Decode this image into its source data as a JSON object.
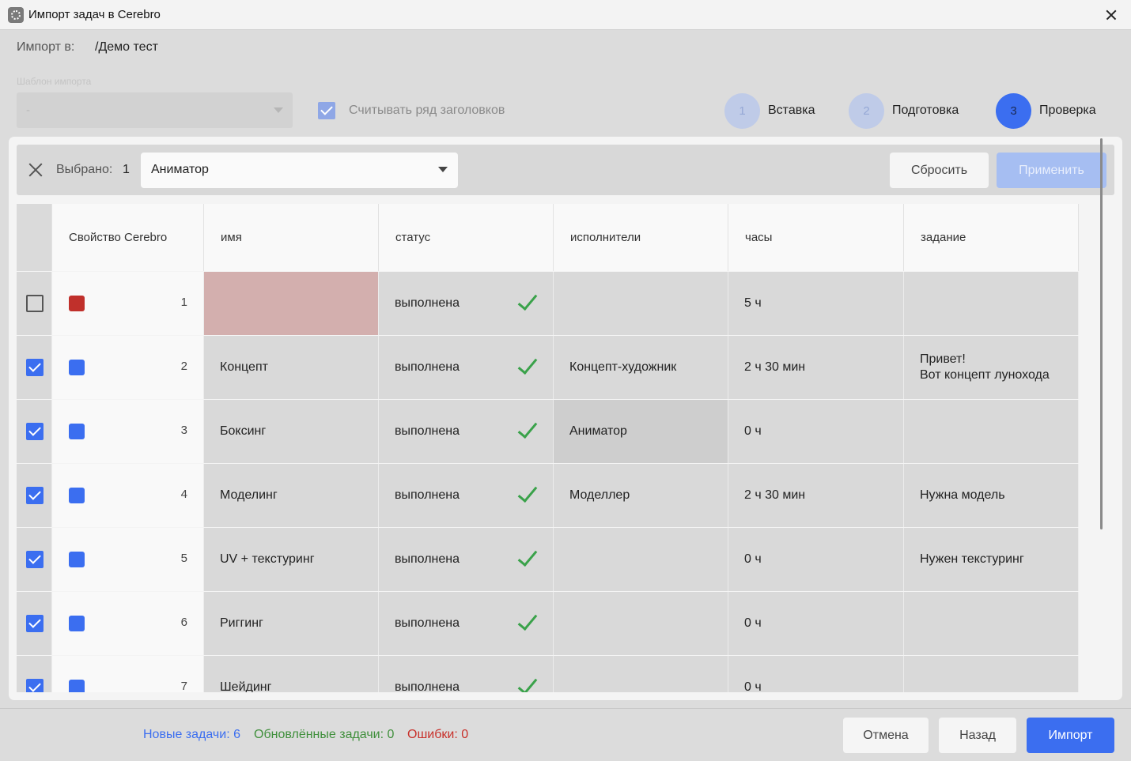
{
  "window": {
    "title": "Импорт задач в Cerebro"
  },
  "import": {
    "label": "Импорт в:",
    "path": "/Демо тест"
  },
  "template": {
    "label": "Шаблон импорта",
    "value": "-"
  },
  "header_row_checkbox": {
    "label": "Считывать ряд заголовков",
    "checked": true
  },
  "steps": [
    {
      "number": "1",
      "label": "Вставка",
      "active": false
    },
    {
      "number": "2",
      "label": "Подготовка",
      "active": false
    },
    {
      "number": "3",
      "label": "Проверка",
      "active": true
    }
  ],
  "toolbar": {
    "selected_label": "Выбрано:",
    "selected_count": "1",
    "assign_value": "Аниматор",
    "reset_label": "Сбросить",
    "apply_label": "Применить"
  },
  "table": {
    "columns": [
      "Свойство Cerebro",
      "имя",
      "статус",
      "исполнители",
      "часы",
      "задание"
    ],
    "rows": [
      {
        "checked": false,
        "color": "#c0302b",
        "num": "1",
        "name": "",
        "status": "выполнена",
        "assignee": "",
        "hours": "5 ч",
        "task": "",
        "name_error": true,
        "assignee_highlight": false
      },
      {
        "checked": true,
        "color": "#3b6ef0",
        "num": "2",
        "name": "Концепт",
        "status": "выполнена",
        "assignee": "Концепт-художник",
        "hours": "2 ч 30 мин",
        "task": "Привет!\nВот концепт лунохода",
        "name_error": false,
        "assignee_highlight": false
      },
      {
        "checked": true,
        "color": "#3b6ef0",
        "num": "3",
        "name": "Боксинг",
        "status": "выполнена",
        "assignee": "Аниматор",
        "hours": "0 ч",
        "task": "",
        "name_error": false,
        "assignee_highlight": true
      },
      {
        "checked": true,
        "color": "#3b6ef0",
        "num": "4",
        "name": "Моделинг",
        "status": "выполнена",
        "assignee": "Моделлер",
        "hours": "2 ч 30 мин",
        "task": "Нужна модель",
        "name_error": false,
        "assignee_highlight": false
      },
      {
        "checked": true,
        "color": "#3b6ef0",
        "num": "5",
        "name": "UV + текстуринг",
        "status": "выполнена",
        "assignee": "",
        "hours": "0 ч",
        "task": "Нужен текстуринг",
        "name_error": false,
        "assignee_highlight": false
      },
      {
        "checked": true,
        "color": "#3b6ef0",
        "num": "6",
        "name": "Риггинг",
        "status": "выполнена",
        "assignee": "",
        "hours": "0 ч",
        "task": "",
        "name_error": false,
        "assignee_highlight": false
      },
      {
        "checked": true,
        "color": "#3b6ef0",
        "num": "7",
        "name": "Шейдинг",
        "status": "выполнена",
        "assignee": "",
        "hours": "0 ч",
        "task": "",
        "name_error": false,
        "assignee_highlight": false
      }
    ]
  },
  "footer": {
    "new_tasks": "Новые задачи: 6",
    "updated_tasks": "Обновлённые задачи: 0",
    "errors": "Ошибки: 0",
    "cancel_label": "Отмена",
    "back_label": "Назад",
    "import_label": "Импорт"
  }
}
